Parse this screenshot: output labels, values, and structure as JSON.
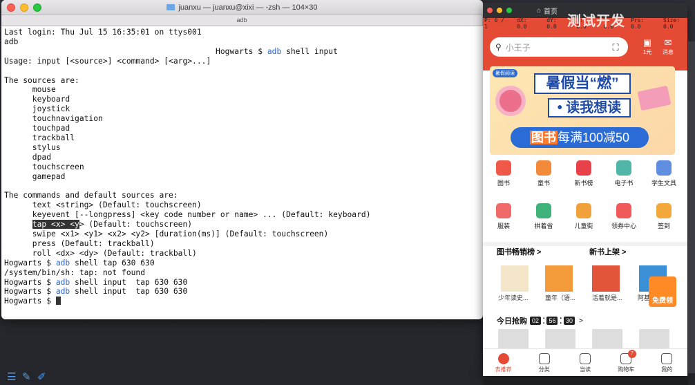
{
  "terminal": {
    "title": "juanxu — juanxu@xixi — -zsh — 104×30",
    "tabs": [
      "adb"
    ],
    "lines": [
      "Last login: Thu Jul 15 16:35:01 on ttys001",
      "adb"
    ],
    "prompt_line_indented": {
      "prompt": "                                             Hogwarts $ ",
      "cmd": "adb",
      "rest": " shell input"
    },
    "usage": "Usage: input [<source>] <command> [<arg>...]",
    "sources_header": "The sources are:",
    "sources": [
      "mouse",
      "keyboard",
      "joystick",
      "touchnavigation",
      "touchpad",
      "trackball",
      "stylus",
      "dpad",
      "touchscreen",
      "gamepad"
    ],
    "commands_header": "The commands and default sources are:",
    "commands": [
      "text <string> (Default: touchscreen)",
      "keyevent [--longpress] <key code number or name> ... (Default: keyboard)"
    ],
    "tap_selected": "tap <x> <y",
    "tap_rest": "> (Default: touchscreen)",
    "commands_after": [
      "swipe <x1> <y1> <x2> <y2> [duration(ms)] (Default: touchscreen)",
      "press (Default: trackball)",
      "roll <dx> <dy> (Default: trackball)"
    ],
    "history": [
      {
        "prompt": "Hogwarts $ ",
        "cmd": "adb",
        "rest": " shell tap 630 630"
      },
      {
        "plain": "/system/bin/sh: tap: not found"
      },
      {
        "prompt": "Hogwarts $ ",
        "cmd": "adb",
        "rest": " shell input  tap 630 630"
      },
      {
        "prompt": "Hogwarts $ ",
        "cmd": "adb",
        "rest": " shell input  tap 630 630"
      }
    ],
    "last_prompt": "Hogwarts $ "
  },
  "phone": {
    "topbar_home": "首页",
    "watermark": "测试开发",
    "status": [
      "P: 0 / 1",
      "dX: 0.0",
      "dY: 0.0",
      "X: 0.0",
      "Y: 0.0",
      "Prs: 0.0",
      "Size: 0.0"
    ],
    "search_placeholder": "小王子",
    "header_icons": [
      {
        "icon": "scan-icon",
        "label": ""
      },
      {
        "icon": "coupon-icon",
        "label": "1元"
      },
      {
        "icon": "message-icon",
        "label": "消息"
      }
    ],
    "banner": {
      "tag": "暑假阅读",
      "line1": "暑假当“燃”",
      "line2": "• 读我想读",
      "line3_a": "图书",
      "line3_b": "每满100减50"
    },
    "grid": [
      {
        "label": "图书",
        "color": "#f0594a"
      },
      {
        "label": "童书",
        "color": "#f28a3a"
      },
      {
        "label": "新书榜",
        "color": "#e9414a"
      },
      {
        "label": "电子书",
        "color": "#4fb6a8"
      },
      {
        "label": "学生文具",
        "color": "#5f8de0"
      },
      {
        "label": "服装",
        "color": "#f06a6a"
      },
      {
        "label": "拼着省",
        "color": "#3fb27a"
      },
      {
        "label": "儿童街",
        "color": "#f2a23a"
      },
      {
        "label": "领券中心",
        "color": "#f05a5a"
      },
      {
        "label": "签到",
        "color": "#f2a83a"
      }
    ],
    "sections": {
      "bestseller": "图书畅销榜 >",
      "newbooks": "新书上架 >"
    },
    "books": [
      "少年读史...",
      "童年（语...",
      "活着就是...",
      "阿基米..."
    ],
    "free_badge": "免费领",
    "flash_sale": "今日抢购",
    "timer": [
      "02",
      "56",
      "30"
    ],
    "nav": [
      {
        "label": "去推荐",
        "active": true
      },
      {
        "label": "分类"
      },
      {
        "label": "当读"
      },
      {
        "label": "购物车",
        "badge": "7"
      },
      {
        "label": "我的"
      }
    ]
  }
}
